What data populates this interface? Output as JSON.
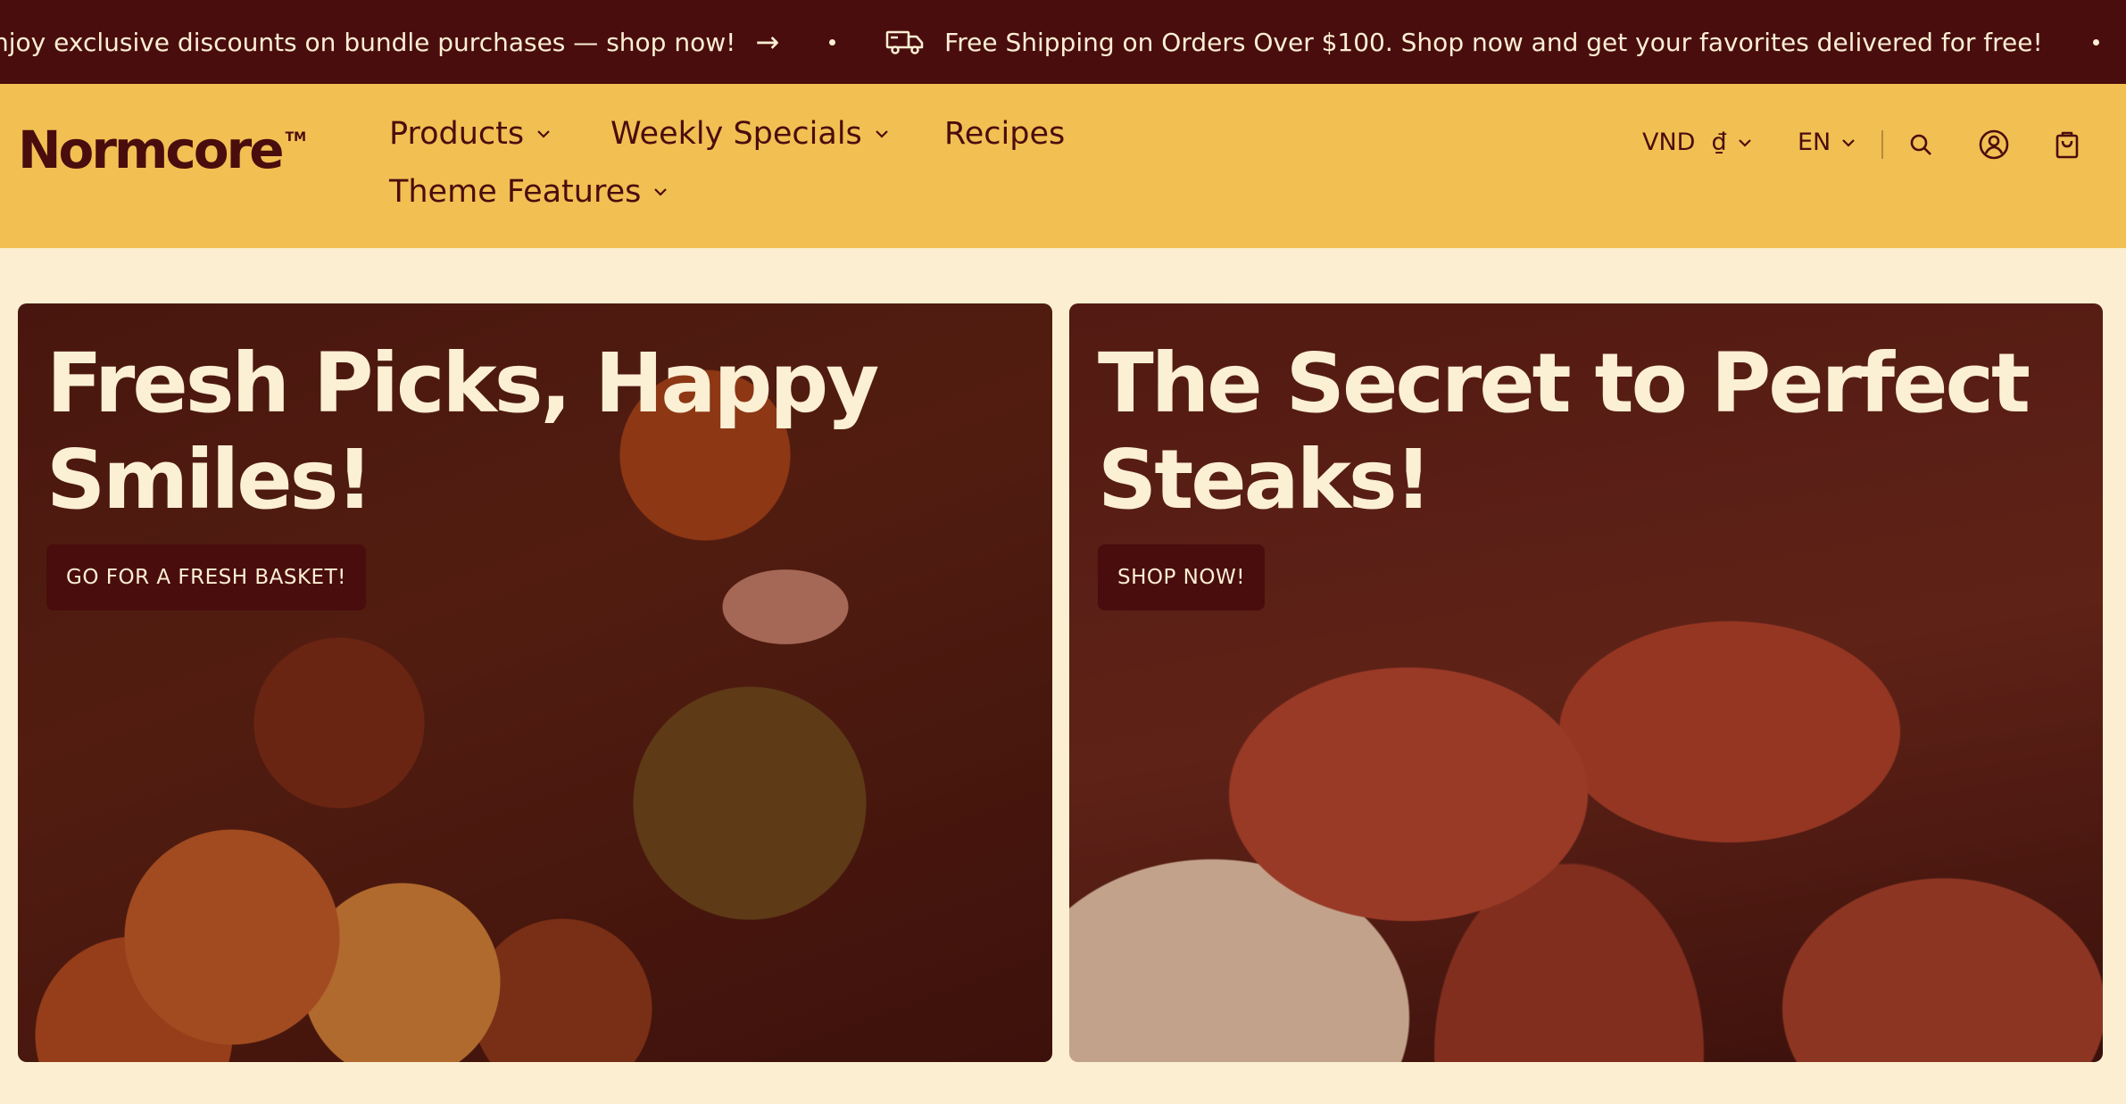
{
  "announcement": {
    "message_1": "njoy exclusive discounts on bundle purchases — shop now!",
    "arrow_glyph": "→",
    "message_2": "Free Shipping on Orders Over $100. Shop now and get your favorites delivered for free!",
    "icons": [
      "arrow-right-icon",
      "truck-icon"
    ]
  },
  "header": {
    "logo": "Normcore",
    "logo_mark": "TM",
    "nav": [
      {
        "label": "Products",
        "has_dropdown": true
      },
      {
        "label": "Weekly Specials",
        "has_dropdown": true
      },
      {
        "label": "Recipes",
        "has_dropdown": false
      },
      {
        "label": "Theme Features",
        "has_dropdown": true
      }
    ],
    "currency": {
      "code": "VND",
      "symbol": "₫"
    },
    "language": "EN",
    "icons": [
      "search-icon",
      "account-icon",
      "cart-icon"
    ]
  },
  "hero_cards": [
    {
      "title_line_1": "Fresh Picks, Happy",
      "title_line_2": "Smiles!",
      "cta": "GO FOR A FRESH BASKET!"
    },
    {
      "title_line_1": "The Secret to Perfect",
      "title_line_2": "Steaks!",
      "cta": "SHOP NOW!"
    }
  ],
  "colors": {
    "maroon": "#4a0d0d",
    "mustard": "#f2bf53",
    "cream": "#fcefd1",
    "cream_text": "#fbefd4"
  }
}
